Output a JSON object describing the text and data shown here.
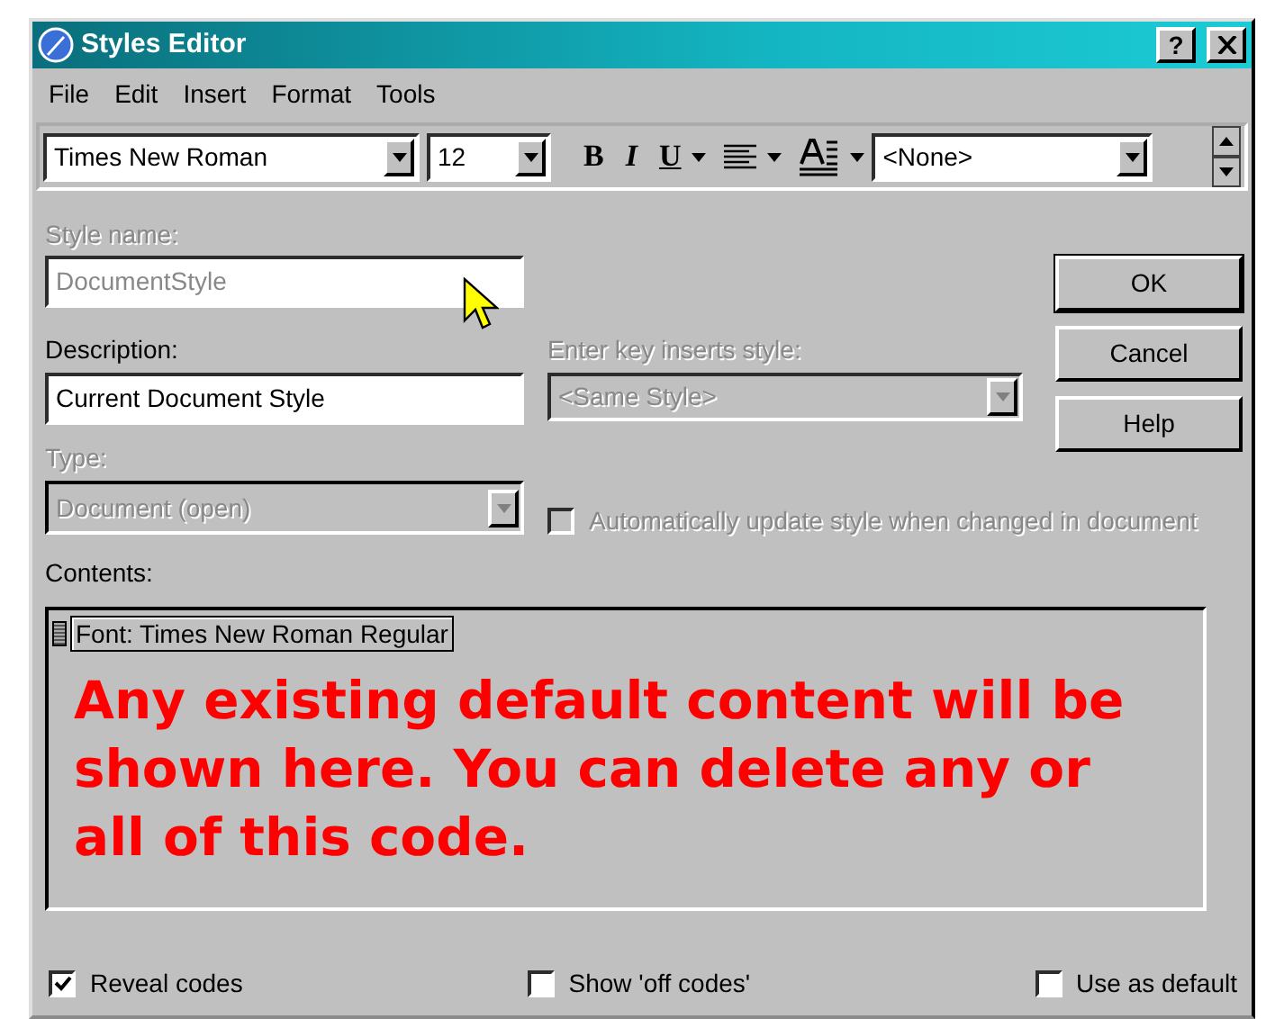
{
  "window": {
    "title": "Styles Editor",
    "title_buttons": [
      {
        "kind": "help",
        "label": "?"
      },
      {
        "kind": "close"
      }
    ]
  },
  "menu": [
    "File",
    "Edit",
    "Insert",
    "Format",
    "Tools"
  ],
  "toolbar": {
    "font": "Times New Roman",
    "size": "12",
    "format_buttons": [
      {
        "label": "B",
        "kind": "bold",
        "dropdown": false
      },
      {
        "label": "I",
        "kind": "italic",
        "dropdown": false
      },
      {
        "label": "U",
        "kind": "underline",
        "dropdown": true
      },
      {
        "kind": "align",
        "dropdown": true
      },
      {
        "kind": "fontcolor",
        "dropdown": true
      }
    ],
    "style": "<None>"
  },
  "style_name": {
    "label": "Style name:",
    "value": "DocumentStyle",
    "disabled": true
  },
  "description": {
    "label": "Description:",
    "value": "Current Document Style"
  },
  "enter_key": {
    "label": "Enter key inserts style:",
    "value": "<Same Style>",
    "disabled": true
  },
  "type": {
    "label": "Type:",
    "value": "Document (open)",
    "disabled": true
  },
  "auto_update": {
    "label": "Automatically update style when changed in document",
    "checked": false,
    "disabled": true
  },
  "buttons": [
    {
      "label": "OK",
      "default": true
    },
    {
      "label": "Cancel",
      "default": false
    },
    {
      "label": "Help",
      "default": false
    }
  ],
  "contents": {
    "label": "Contents:",
    "code": "Font: Times New Roman Regular",
    "annotation": "Any existing default content will be shown here. You can delete any or all of this code."
  },
  "options": [
    {
      "label": "Reveal codes",
      "checked": true
    },
    {
      "label": "Show 'off codes'",
      "checked": false
    },
    {
      "label": "Use as default",
      "checked": false
    }
  ]
}
